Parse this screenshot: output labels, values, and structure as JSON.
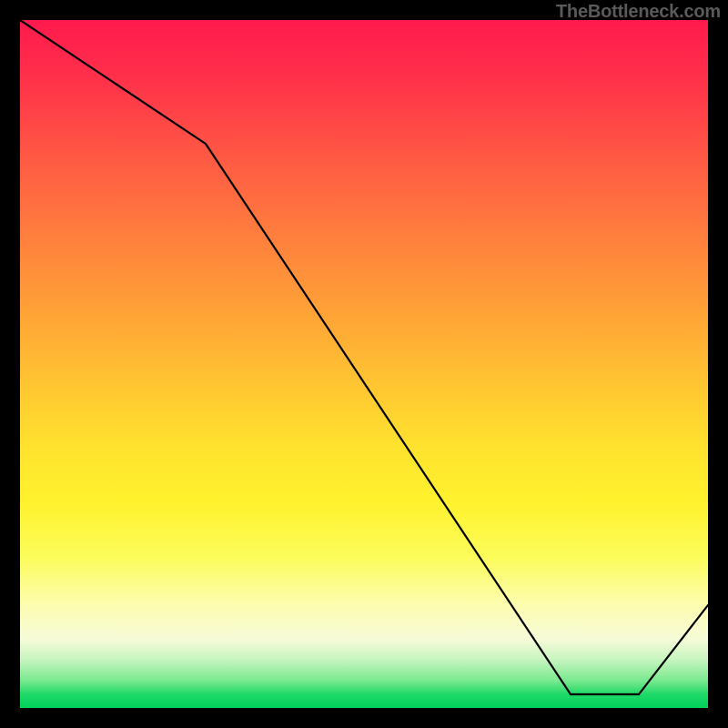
{
  "watermark": "TheBottleneck.com",
  "flat_segment_label": "",
  "chart_data": {
    "type": "line",
    "x": [
      0,
      0.27,
      0.8,
      0.9,
      1.0
    ],
    "y": [
      100,
      82,
      2,
      2,
      15
    ],
    "flat_segment": {
      "x_start": 0.8,
      "x_end": 0.9,
      "y": 2
    },
    "title": "",
    "xlabel": "",
    "ylabel": "",
    "xlim": [
      0,
      1
    ],
    "ylim": [
      0,
      100
    ],
    "background_gradient": {
      "direction": "top-to-bottom",
      "stops": [
        {
          "pos": 0.0,
          "color": "#ff1a4d"
        },
        {
          "pos": 0.3,
          "color": "#ff7a3e"
        },
        {
          "pos": 0.62,
          "color": "#ffe22e"
        },
        {
          "pos": 0.85,
          "color": "#fdfdb0"
        },
        {
          "pos": 0.96,
          "color": "#7ae98f"
        },
        {
          "pos": 1.0,
          "color": "#00d05a"
        }
      ]
    }
  }
}
